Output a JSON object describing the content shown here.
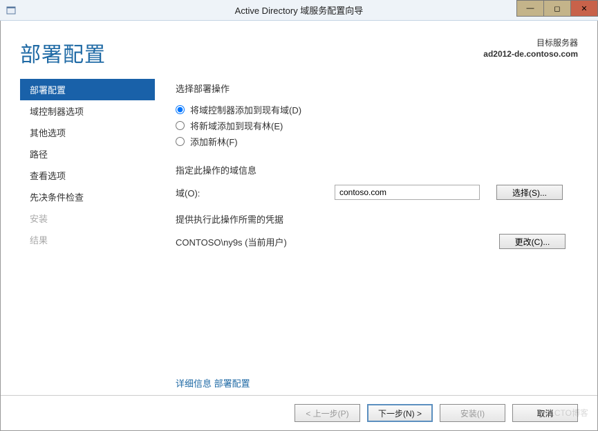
{
  "window": {
    "title": "Active Directory 域服务配置向导"
  },
  "header": {
    "page_title": "部署配置",
    "target_label": "目标服务器",
    "target_server": "ad2012-de.contoso.com"
  },
  "sidenav": {
    "items": [
      {
        "label": "部署配置",
        "state": "active"
      },
      {
        "label": "域控制器选项",
        "state": "normal"
      },
      {
        "label": "其他选项",
        "state": "normal"
      },
      {
        "label": "路径",
        "state": "normal"
      },
      {
        "label": "查看选项",
        "state": "normal"
      },
      {
        "label": "先决条件检查",
        "state": "normal"
      },
      {
        "label": "安装",
        "state": "disabled"
      },
      {
        "label": "结果",
        "state": "disabled"
      }
    ]
  },
  "content": {
    "op_header": "选择部署操作",
    "radios": [
      {
        "label": "将域控制器添加到现有域(D)",
        "checked": true
      },
      {
        "label": "将新域添加到现有林(E)",
        "checked": false
      },
      {
        "label": "添加新林(F)",
        "checked": false
      }
    ],
    "domain_info_header": "指定此操作的域信息",
    "domain_label": "域(O):",
    "domain_value": "contoso.com",
    "select_btn": "选择(S)...",
    "cred_header": "提供执行此操作所需的凭据",
    "cred_text": "CONTOSO\\ny9s (当前用户)",
    "change_btn": "更改(C)...",
    "more_prefix": "详细信息 ",
    "more_link": "部署配置"
  },
  "footer": {
    "prev": "< 上一步(P)",
    "next": "下一步(N) >",
    "install": "安装(I)",
    "cancel": "取消"
  },
  "watermark": "©51CTO博客"
}
